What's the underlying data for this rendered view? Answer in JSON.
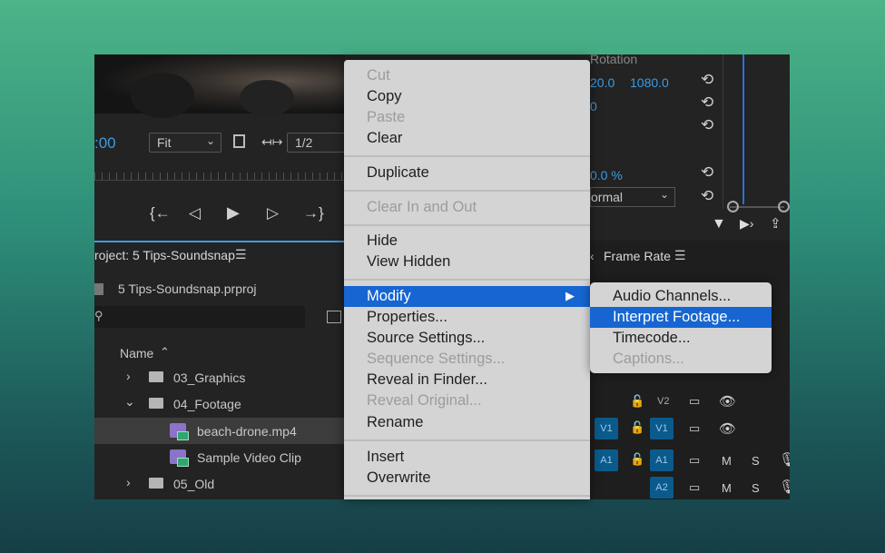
{
  "source_monitor": {
    "timecode": ":00",
    "fit_value": "Fit",
    "resolution": "1/2"
  },
  "effect_controls": {
    "rotation_label": "Rotation",
    "rotation_value": "0.0",
    "anchor_x": "20.0",
    "anchor_y": "1080.0",
    "val_row2": "0",
    "opacity": "0.0 %",
    "blend_mode": "ormal"
  },
  "project": {
    "title": "roject: 5 Tips-Soundsnap",
    "file": "5 Tips-Soundsnap.prproj",
    "column_name": "Name",
    "items": [
      {
        "label": "03_Graphics",
        "type": "folder"
      },
      {
        "label": "04_Footage",
        "type": "folder"
      },
      {
        "label": "beach-drone.mp4",
        "type": "clip"
      },
      {
        "label": "Sample Video Clip",
        "type": "clip"
      },
      {
        "label": "05_Old",
        "type": "folder"
      }
    ]
  },
  "timeline": {
    "column_frame_rate": "Frame Rate",
    "tracks": [
      "V2",
      "V1",
      "V1",
      "A1",
      "A1",
      "A2"
    ],
    "mute": "M",
    "solo": "S"
  },
  "context_menu": {
    "items": [
      {
        "label": "Cut",
        "enabled": false
      },
      {
        "label": "Copy",
        "enabled": true
      },
      {
        "label": "Paste",
        "enabled": false
      },
      {
        "label": "Clear",
        "enabled": true
      },
      {
        "label": "Duplicate",
        "enabled": true
      },
      {
        "label": "Clear In and Out",
        "enabled": false
      },
      {
        "label": "Hide",
        "enabled": true
      },
      {
        "label": "View Hidden",
        "enabled": true
      },
      {
        "label": "Modify",
        "enabled": true,
        "highlighted": true
      },
      {
        "label": "Properties...",
        "enabled": true
      },
      {
        "label": "Source Settings...",
        "enabled": true
      },
      {
        "label": "Sequence Settings...",
        "enabled": false
      },
      {
        "label": "Reveal in Finder...",
        "enabled": true
      },
      {
        "label": "Reveal Original...",
        "enabled": false
      },
      {
        "label": "Rename",
        "enabled": true
      },
      {
        "label": "Insert",
        "enabled": true
      },
      {
        "label": "Overwrite",
        "enabled": true
      }
    ]
  },
  "submenu": {
    "items": [
      {
        "label": "Audio Channels...",
        "enabled": true
      },
      {
        "label": "Interpret Footage...",
        "enabled": true,
        "highlighted": true
      },
      {
        "label": "Timecode...",
        "enabled": true
      },
      {
        "label": "Captions...",
        "enabled": false
      }
    ]
  },
  "colors": {
    "accent": "#1665d1",
    "timecode_blue": "#3a9be5",
    "menu_bg": "#d4d4d4",
    "app_bg": "#232323"
  }
}
